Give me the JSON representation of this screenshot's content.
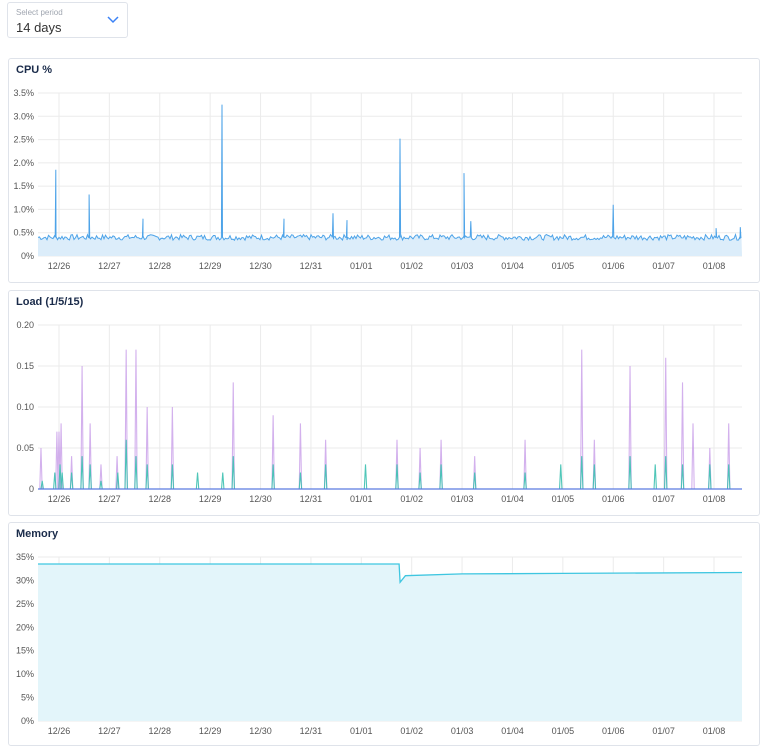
{
  "period_select": {
    "label": "Select period",
    "value": "14 days"
  },
  "colors": {
    "cpu": "#4da3e8",
    "cpu_fill": "#dcedfa",
    "load_a": "#c89ee8",
    "load_b": "#3cc0b0",
    "load_base": "#5b7be0",
    "memory": "#3fc6e0",
    "memory_fill": "#e3f5fa",
    "grid": "#ebebeb"
  },
  "chart_data": [
    {
      "type": "area",
      "title": "CPU %",
      "range": [
        "12/25 14:00",
        "01/08 13:20"
      ],
      "ylim": [
        0,
        3.5
      ],
      "yticks": [
        "0%",
        "0.5%",
        "1.0%",
        "1.5%",
        "2.0%",
        "2.5%",
        "3.0%",
        "3.5%"
      ],
      "ytick_values": [
        0,
        0.5,
        1,
        1.5,
        2,
        2.5,
        3,
        3.5
      ],
      "xticks": [
        "12/26",
        "12/27",
        "12/28",
        "12/29",
        "12/30",
        "12/31",
        "01/01",
        "01/02",
        "01/03",
        "01/04",
        "01/05",
        "01/06",
        "01/07",
        "01/08"
      ],
      "grid": true,
      "baseline": 0.4,
      "spikes": [
        [
          "12/25 22:30",
          1.85
        ],
        [
          "12/26 14:20",
          1.32
        ],
        [
          "12/27 16:00",
          0.8
        ],
        [
          "12/29 05:40",
          3.25
        ],
        [
          "12/30 11:10",
          0.8
        ],
        [
          "12/31 10:30",
          0.92
        ],
        [
          "12/31 17:10",
          0.77
        ],
        [
          "01/01 18:25",
          2.52
        ],
        [
          "01/03 00:55",
          1.78
        ],
        [
          "01/03 04:10",
          0.75
        ],
        [
          "01/06 00:00",
          1.1
        ],
        [
          "01/08 01:00",
          0.6
        ],
        [
          "01/08 12:30",
          0.62
        ]
      ]
    },
    {
      "type": "line",
      "title": "Load (1/5/15)",
      "range": [
        "12/25 14:00",
        "01/08 13:20"
      ],
      "ylim": [
        0,
        0.2
      ],
      "yticks": [
        "0",
        "0.05",
        "0.10",
        "0.15",
        "0.20"
      ],
      "ytick_values": [
        0,
        0.05,
        0.1,
        0.15,
        0.2
      ],
      "xticks": [
        "12/26",
        "12/27",
        "12/28",
        "12/29",
        "12/30",
        "12/31",
        "01/01",
        "01/02",
        "01/03",
        "01/04",
        "01/05",
        "01/06",
        "01/07",
        "01/08"
      ],
      "grid": true,
      "series": [
        {
          "values": [
            [
              "12/25 15:25",
              0.05
            ],
            [
              "12/25 23:00",
              0.07
            ],
            [
              "12/26 00:00",
              0.07
            ],
            [
              "12/26 01:00",
              0.08
            ],
            [
              "12/26 06:00",
              0.04
            ],
            [
              "12/26 11:00",
              0.15
            ],
            [
              "12/26 14:50",
              0.08
            ],
            [
              "12/26 20:00",
              0.03
            ],
            [
              "12/27 03:40",
              0.04
            ],
            [
              "12/27 08:00",
              0.17
            ],
            [
              "12/27 12:40",
              0.17
            ],
            [
              "12/27 18:00",
              0.1
            ],
            [
              "12/28 06:00",
              0.1
            ],
            [
              "12/29 11:00",
              0.13
            ],
            [
              "12/30 06:00",
              0.09
            ],
            [
              "12/30 19:00",
              0.08
            ],
            [
              "12/31 07:00",
              0.06
            ],
            [
              "01/01 17:00",
              0.06
            ],
            [
              "01/02 04:00",
              0.05
            ],
            [
              "01/02 14:00",
              0.06
            ],
            [
              "01/03 06:00",
              0.04
            ],
            [
              "01/04 06:00",
              0.06
            ],
            [
              "01/05 09:00",
              0.17
            ],
            [
              "01/05 15:00",
              0.06
            ],
            [
              "01/06 08:00",
              0.15
            ],
            [
              "01/07 01:00",
              0.16
            ],
            [
              "01/07 09:00",
              0.13
            ],
            [
              "01/07 14:00",
              0.08
            ],
            [
              "01/07 22:00",
              0.05
            ],
            [
              "01/08 07:00",
              0.08
            ]
          ]
        },
        {
          "values": [
            [
              "12/25 16:00",
              0.01
            ],
            [
              "12/25 22:00",
              0.02
            ],
            [
              "12/26 00:30",
              0.03
            ],
            [
              "12/26 01:30",
              0.02
            ],
            [
              "12/26 06:00",
              0.02
            ],
            [
              "12/26 11:00",
              0.04
            ],
            [
              "12/26 14:50",
              0.03
            ],
            [
              "12/26 20:00",
              0.01
            ],
            [
              "12/27 04:00",
              0.02
            ],
            [
              "12/27 08:00",
              0.06
            ],
            [
              "12/27 12:40",
              0.04
            ],
            [
              "12/27 18:00",
              0.03
            ],
            [
              "12/28 06:00",
              0.03
            ],
            [
              "12/28 18:00",
              0.02
            ],
            [
              "12/29 06:00",
              0.02
            ],
            [
              "12/29 11:00",
              0.04
            ],
            [
              "12/30 06:00",
              0.03
            ],
            [
              "12/30 19:00",
              0.02
            ],
            [
              "12/31 07:00",
              0.03
            ],
            [
              "01/01 02:00",
              0.03
            ],
            [
              "01/01 17:00",
              0.03
            ],
            [
              "01/02 04:00",
              0.02
            ],
            [
              "01/02 14:00",
              0.03
            ],
            [
              "01/03 06:00",
              0.02
            ],
            [
              "01/04 06:00",
              0.02
            ],
            [
              "01/04 23:00",
              0.03
            ],
            [
              "01/05 09:00",
              0.04
            ],
            [
              "01/05 15:00",
              0.03
            ],
            [
              "01/06 08:00",
              0.04
            ],
            [
              "01/06 20:00",
              0.03
            ],
            [
              "01/07 01:00",
              0.04
            ],
            [
              "01/07 09:00",
              0.03
            ],
            [
              "01/07 22:00",
              0.03
            ],
            [
              "01/08 07:00",
              0.03
            ]
          ]
        }
      ]
    },
    {
      "type": "area",
      "title": "Memory",
      "range": [
        "12/25 14:00",
        "01/08 13:20"
      ],
      "ylim": [
        0,
        35
      ],
      "yticks": [
        "0%",
        "5%",
        "10%",
        "15%",
        "20%",
        "25%",
        "30%",
        "35%"
      ],
      "ytick_values": [
        0,
        5,
        10,
        15,
        20,
        25,
        30,
        35
      ],
      "xticks": [
        "12/26",
        "12/27",
        "12/28",
        "12/29",
        "12/30",
        "12/31",
        "01/01",
        "01/02",
        "01/03",
        "01/04",
        "01/05",
        "01/06",
        "01/07",
        "01/08"
      ],
      "grid": true,
      "values": [
        [
          "12/25 14:00",
          33.5
        ],
        [
          "01/01 18:00",
          33.5
        ],
        [
          "01/01 18:30",
          29.6
        ],
        [
          "01/01 21:00",
          31.0
        ],
        [
          "01/03 00:00",
          31.4
        ],
        [
          "01/05 00:00",
          31.5
        ],
        [
          "01/08 13:20",
          31.7
        ]
      ]
    }
  ]
}
